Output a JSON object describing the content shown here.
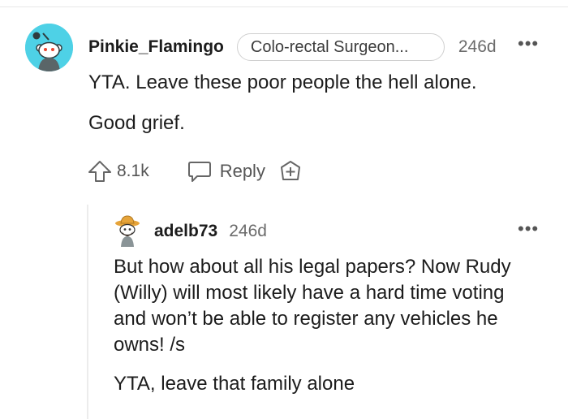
{
  "comment": {
    "author": "Pinkie_Flamingo",
    "flair": "Colo-rectal Surgeon...",
    "age": "246d",
    "more": "•••",
    "paragraphs": [
      "YTA. Leave these poor people the hell alone.",
      "Good grief."
    ],
    "upvotes": "8.1k",
    "reply_label": "Reply",
    "avatar_color": "#4ed1e6"
  },
  "reply": {
    "author": "adelb73",
    "age": "246d",
    "more": "•••",
    "paragraphs": [
      "But how about all his legal papers? Now Rudy (Willy) will most likely have a hard time voting and won’t be able to register any vehicles he owns! /s",
      "YTA, leave that family alone"
    ]
  },
  "icons": {
    "upvote": "upvote-arrow-icon",
    "reply": "speech-bubble-icon",
    "award": "award-plus-icon",
    "more": "ellipsis-icon"
  }
}
